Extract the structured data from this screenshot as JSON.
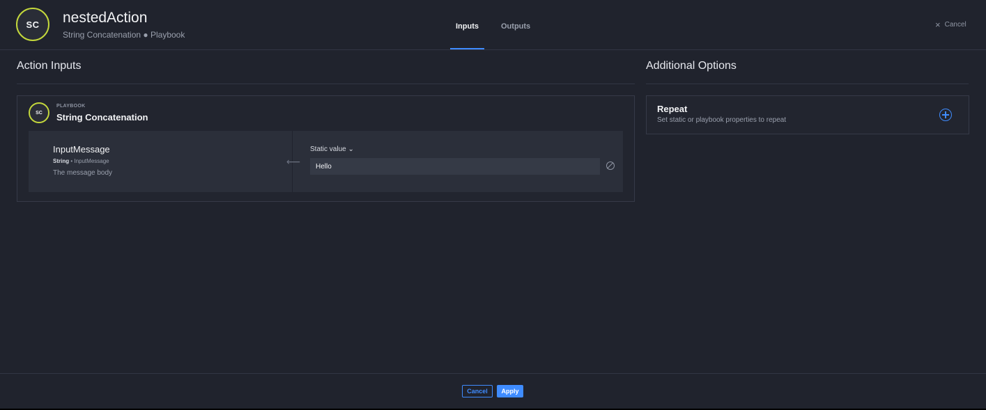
{
  "header": {
    "avatar_initials": "SC",
    "title": "nestedAction",
    "subtitle": "String Concatenation ● Playbook",
    "tabs": [
      {
        "label": "Inputs",
        "active": true
      },
      {
        "label": "Outputs",
        "active": false
      }
    ],
    "close_label": "Cancel",
    "close_icon": "close-icon"
  },
  "action_inputs": {
    "section_title": "Action Inputs",
    "card": {
      "avatar_initials": "SC",
      "kind": "PLAYBOOK",
      "name": "String Concatenation",
      "param": {
        "name": "InputMessage",
        "type": "String",
        "separator": " • ",
        "type_ref": "InputMessage",
        "description": "The message body",
        "value_mode": "Static value",
        "value": "Hello"
      }
    }
  },
  "additional_options": {
    "section_title": "Additional Options",
    "repeat": {
      "title": "Repeat",
      "description": "Set static or playbook properties to repeat"
    }
  },
  "footer": {
    "cancel_label": "Cancel",
    "apply_label": "Apply"
  },
  "colors": {
    "background": "#20232d",
    "accent": "#3f8cff",
    "avatar_ring": "#c4d83c"
  }
}
